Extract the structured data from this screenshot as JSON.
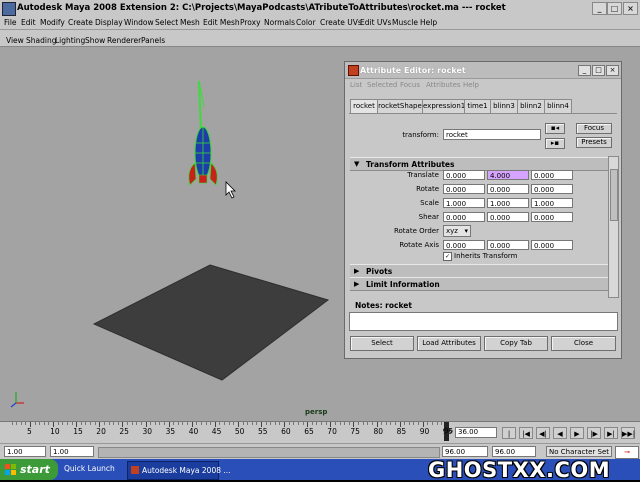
{
  "window": {
    "title": "Autodesk Maya 2008 Extension 2: C:\\Projects\\MayaPodcasts\\ATributeToAttributes\\rocket.ma  ---  rocket"
  },
  "main_menu": [
    "File",
    "Edit",
    "Modify",
    "Create",
    "Display",
    "Window",
    "Select",
    "Mesh",
    "Edit Mesh",
    "Proxy",
    "Normals",
    "Color",
    "Create UVs",
    "Edit UVs",
    "Muscle",
    "Help"
  ],
  "panel_menu": [
    "View",
    "Shading",
    "Lighting",
    "Show",
    "Renderer",
    "Panels"
  ],
  "viewport": {
    "camera_label": "persp",
    "background": "#a3a3a3"
  },
  "attribute_editor": {
    "title": "Attribute Editor: rocket",
    "menu": [
      "List",
      "Selected",
      "Focus",
      "Attributes",
      "Help"
    ],
    "tabs": [
      "rocket",
      "rocketShape",
      "expression1",
      "time1",
      "blinn3",
      "blinn2",
      "blinn4"
    ],
    "transform_label": "transform:",
    "transform_value": "rocket",
    "focus_button": "Focus",
    "presets_button": "Presets",
    "sections": {
      "transform_attributes": "Transform Attributes",
      "pivots": "Pivots",
      "limit_information": "Limit Information"
    },
    "attributes": {
      "translate": {
        "label": "Translate",
        "values": [
          "0.000",
          "4.000",
          "0.000"
        ]
      },
      "rotate": {
        "label": "Rotate",
        "values": [
          "0.000",
          "0.000",
          "0.000"
        ]
      },
      "scale": {
        "label": "Scale",
        "values": [
          "1.000",
          "1.000",
          "1.000"
        ]
      },
      "shear": {
        "label": "Shear",
        "values": [
          "0.000",
          "0.000",
          "0.000"
        ]
      },
      "rotate_order": {
        "label": "Rotate Order",
        "value": "xyz"
      },
      "rotate_axis": {
        "label": "Rotate Axis",
        "values": [
          "0.000",
          "0.000",
          "0.000"
        ]
      },
      "inherits_transform": {
        "label": "Inherits Transform",
        "checked": true
      }
    },
    "notes_label": "Notes:  rocket",
    "buttons": {
      "select": "Select",
      "load": "Load Attributes",
      "copy": "Copy Tab",
      "close": "Close"
    },
    "highlight_color": "#d6a4ff"
  },
  "timeline": {
    "tick_labels": [
      "5",
      "10",
      "15",
      "20",
      "25",
      "30",
      "35",
      "40",
      "45",
      "50",
      "55",
      "60",
      "65",
      "70",
      "75",
      "80",
      "85",
      "90",
      "95"
    ],
    "current_frame": "36.00",
    "playhead_label": "96"
  },
  "range": {
    "start": "1.00",
    "start_inner": "1.00",
    "end_inner": "96.00",
    "end": "96.00",
    "character_set": "No Character Set"
  },
  "taskbar": {
    "start": "start",
    "quick_launch": "Quick Launch",
    "task_label": "Autodesk Maya 2008 ..."
  },
  "watermark": "GHOSTXX.COM"
}
